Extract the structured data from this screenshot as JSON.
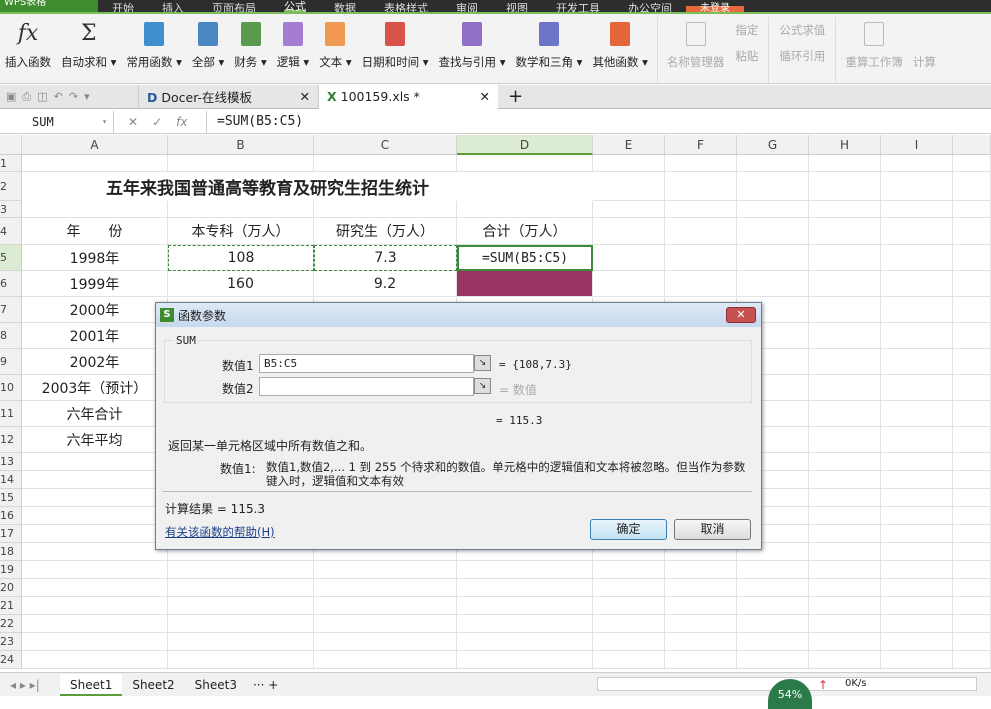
{
  "menu": {
    "app": "WPS表格",
    "tabs": [
      "开始",
      "插入",
      "页面布局",
      "公式",
      "数据",
      "表格样式",
      "审阅",
      "视图",
      "开发工具",
      "办公空间"
    ],
    "active": "公式",
    "login": "未登录"
  },
  "ribbon": {
    "insert_function": "插入函数",
    "autosum": "自动求和",
    "groups": [
      {
        "label": "常用函数",
        "color": "#3f8fcf"
      },
      {
        "label": "全部",
        "color": "#4a86c4"
      },
      {
        "label": "财务",
        "color": "#5a9a4e"
      },
      {
        "label": "逻辑",
        "color": "#a57dd0"
      },
      {
        "label": "文本",
        "color": "#ef9a50"
      },
      {
        "label": "日期和时间",
        "color": "#d9534a"
      },
      {
        "label": "查找与引用",
        "color": "#9370c8"
      },
      {
        "label": "数学和三角",
        "color": "#6b74c6"
      },
      {
        "label": "其他函数",
        "color": "#e5663a"
      }
    ],
    "name_manager": "名称管理器",
    "specify": "指定",
    "paste": "粘贴",
    "formula_eval": "公式求值",
    "circular_ref": "循环引用",
    "recalc_workbook": "重算工作簿",
    "calc": "计算"
  },
  "doc_tabs": [
    {
      "label": "Docer-在线模板"
    },
    {
      "label": "100159.xls *"
    }
  ],
  "formula_bar": {
    "name_box": "SUM",
    "formula": "=SUM(B5:C5)"
  },
  "columns": [
    "A",
    "B",
    "C",
    "D",
    "E",
    "F",
    "G",
    "H",
    "I"
  ],
  "rows": [
    "1",
    "2",
    "3",
    "4",
    "5",
    "6",
    "7",
    "8",
    "9",
    "10",
    "11",
    "12",
    "13",
    "14",
    "15",
    "16",
    "17",
    "18",
    "19",
    "20",
    "21",
    "22",
    "23",
    "24"
  ],
  "sheet": {
    "title": "五年来我国普通高等教育及研究生招生统计",
    "headers": [
      "年　　份",
      "本专科（万人）",
      "研究生（万人）",
      "合计（万人）"
    ],
    "data": [
      [
        "1998年",
        "108",
        "7.3",
        "=SUM(B5:C5)"
      ],
      [
        "1999年",
        "160",
        "9.2",
        ""
      ],
      [
        "2000年",
        "",
        "",
        ""
      ],
      [
        "2001年",
        "",
        "",
        ""
      ],
      [
        "2002年",
        "",
        "",
        ""
      ],
      [
        "2003年（预计）",
        "",
        "",
        ""
      ],
      [
        "六年合计",
        "",
        "",
        ""
      ],
      [
        "六年平均",
        "",
        "",
        ""
      ]
    ]
  },
  "dialog": {
    "title": "函数参数",
    "function": "SUM",
    "arg1_label": "数值1",
    "arg1_value": "B5:C5",
    "arg1_result": "= {108,7.3}",
    "arg2_label": "数值2",
    "arg2_value": "",
    "arg2_result": "= 数值",
    "result_line": "= 115.3",
    "description": "返回某一单元格区域中所有数值之和。",
    "arg_help_label": "数值1:",
    "arg_help": "数值1,数值2,... 1 到 255 个待求和的数值。单元格中的逻辑值和文本将被忽略。但当作为参数键入时，逻辑值和文本有效",
    "calc_result": "计算结果 = 115.3",
    "help_link": "有关该函数的帮助(H)",
    "ok": "确定",
    "cancel": "取消"
  },
  "sheets": [
    "Sheet1",
    "Sheet2",
    "Sheet3"
  ],
  "active_sheet": "Sheet1",
  "status": {
    "percent": "54%",
    "speed": "0K/s"
  }
}
